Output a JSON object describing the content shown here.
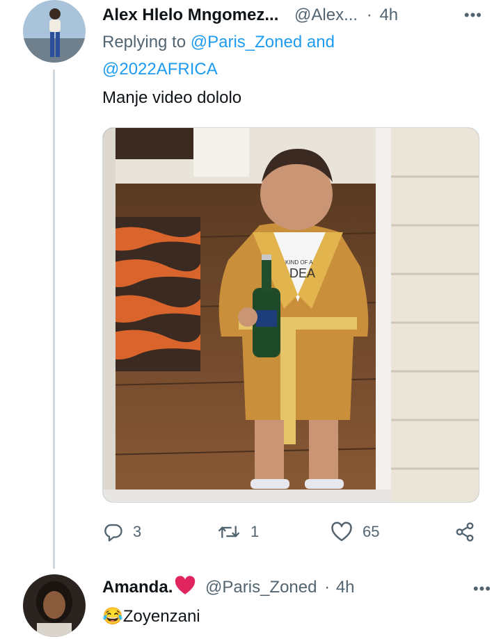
{
  "tweet": {
    "author_name": "Alex Hlelo Mngomez...",
    "handle": "@Alex...",
    "separator": "·",
    "time": "4h",
    "replying_to_label": "Replying to",
    "mention_1": "@Paris_Zoned",
    "and_word": "and",
    "mention_2": "@2022AFRICA",
    "text": "Manje video dololo",
    "image_shirt_text_1": "KIND OF A",
    "image_shirt_text_2": "DEA",
    "stats": {
      "replies": "3",
      "retweets": "1",
      "likes": "65"
    }
  },
  "reply": {
    "author_name": "Amanda.",
    "handle": "@Paris_Zoned",
    "separator": "·",
    "time": "4h",
    "emoji": "😂",
    "text": "Zoyenzani"
  },
  "icons": {
    "more": "more-icon",
    "reply": "reply-icon",
    "retweet": "retweet-icon",
    "like": "heart-icon",
    "share": "share-icon",
    "heart_badge": "red-heart-icon"
  },
  "colors": {
    "link": "#1d9bf0",
    "muted": "#536471",
    "heart": "#e0245e"
  }
}
